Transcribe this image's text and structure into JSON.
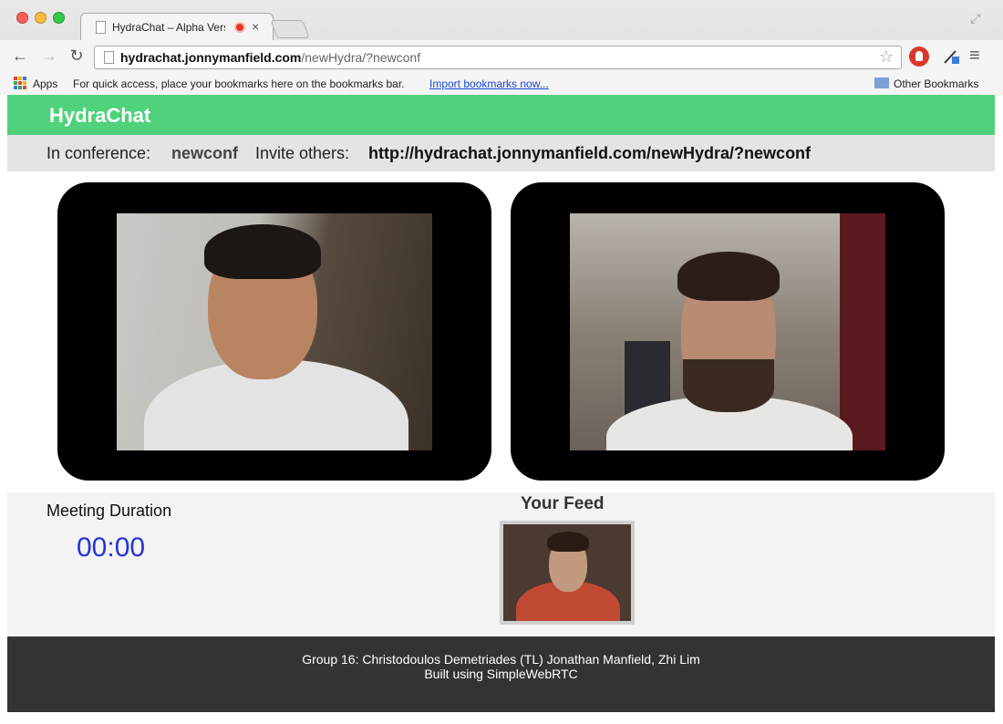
{
  "browser": {
    "tab_title": "HydraChat – Alpha Vers",
    "url_host": "hydrachat.jonnymanfield.com",
    "url_path": "/newHydra/?newconf",
    "bookmarks": {
      "apps": "Apps",
      "hint": "For quick access, place your bookmarks here on the bookmarks bar.",
      "import": "Import bookmarks now...",
      "other": "Other Bookmarks"
    }
  },
  "app": {
    "brand": "HydraChat",
    "brand_color": "#4fd27b",
    "conference_label": "In conference:",
    "conference_name": "newconf",
    "invite_label": "Invite others:",
    "invite_url": "http://hydrachat.jonnymanfield.com/newHydra/?newconf"
  },
  "meeting": {
    "duration_label": "Meeting Duration",
    "duration_value": "00:00",
    "feed_title": "Your Feed"
  },
  "footer": {
    "line1": "Group 16: Christodoulos Demetriades (TL) Jonathan Manfield, Zhi Lim",
    "line2": "Built using SimpleWebRTC"
  }
}
